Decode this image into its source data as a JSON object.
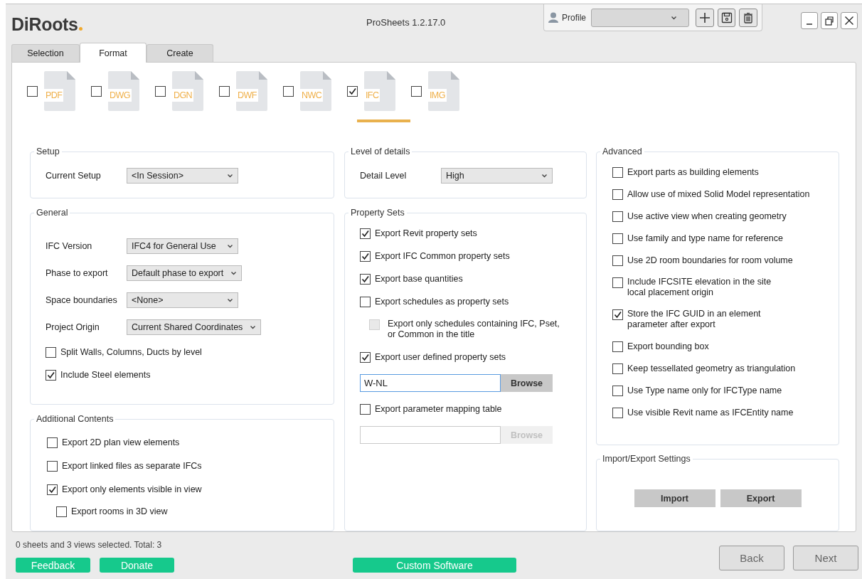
{
  "window": {
    "logo": "DiRoots",
    "title": "ProSheets 1.2.17.0"
  },
  "profile": {
    "label": "Profile"
  },
  "tabs": [
    {
      "label": "Selection",
      "selected": false
    },
    {
      "label": "Format",
      "selected": true
    },
    {
      "label": "Create",
      "selected": false
    }
  ],
  "formats": [
    {
      "label": "PDF",
      "checked": false,
      "selected": false
    },
    {
      "label": "DWG",
      "checked": false,
      "selected": false
    },
    {
      "label": "DGN",
      "checked": false,
      "selected": false
    },
    {
      "label": "DWF",
      "checked": false,
      "selected": false
    },
    {
      "label": "NWC",
      "checked": false,
      "selected": false
    },
    {
      "label": "IFC",
      "checked": true,
      "selected": true
    },
    {
      "label": "IMG",
      "checked": false,
      "selected": false
    }
  ],
  "setup": {
    "title": "Setup",
    "fields": [
      {
        "label": "Current Setup",
        "value": "<In Session>"
      }
    ]
  },
  "general": {
    "title": "General",
    "fields": [
      {
        "label": "IFC Version",
        "value": "IFC4 for General Use"
      },
      {
        "label": "Phase to export",
        "value": "Default phase to export"
      },
      {
        "label": "Space boundaries",
        "value": "<None>"
      },
      {
        "label": "Project Origin",
        "value": "Current Shared Coordinates"
      }
    ],
    "options": [
      {
        "label": "Split Walls, Columns, Ducts by level",
        "checked": false
      },
      {
        "label": "Include Steel elements",
        "checked": true
      }
    ]
  },
  "additional_contents": {
    "title": "Additional Contents",
    "options": [
      {
        "label": "Export 2D plan view elements",
        "checked": false
      },
      {
        "label": "Export linked files as separate IFCs",
        "checked": false
      },
      {
        "label": "Export only elements visible in view",
        "checked": true,
        "children": [
          {
            "label": "Export rooms in 3D view",
            "checked": false
          }
        ]
      }
    ]
  },
  "level_of_details": {
    "title": "Level of details",
    "fields": [
      {
        "label": "Detail Level",
        "value": "High"
      }
    ]
  },
  "property_sets": {
    "title": "Property Sets",
    "items": [
      {
        "kind": "checkbox",
        "label": "Export Revit property sets",
        "checked": true,
        "disabled": false
      },
      {
        "kind": "checkbox",
        "label": "Export IFC Common property sets",
        "checked": true,
        "disabled": false
      },
      {
        "kind": "checkbox",
        "label": "Export base quantities",
        "checked": true,
        "disabled": false
      },
      {
        "kind": "checkbox",
        "label": "Export schedules as property sets",
        "checked": false,
        "disabled": false,
        "children": [
          {
            "label": "Export only schedules containing IFC, Pset,\nor Common in the title",
            "checked": false,
            "disabled": true
          }
        ]
      },
      {
        "kind": "checkbox",
        "label": "Export user defined property sets",
        "checked": true,
        "disabled": false
      },
      {
        "kind": "file",
        "value": "W-NL",
        "button": "Browse",
        "focused": true,
        "disabled": false
      },
      {
        "kind": "checkbox",
        "label": "Export parameter mapping table",
        "checked": false,
        "disabled": false
      },
      {
        "kind": "file",
        "button": "Browse",
        "focused": false,
        "disabled": true
      }
    ]
  },
  "advanced": {
    "title": "Advanced",
    "options": [
      {
        "label": "Export parts as building elements",
        "checked": false
      },
      {
        "label": "Allow use of mixed Solid Model representation",
        "checked": false
      },
      {
        "label": "Use active view when creating geometry",
        "checked": false
      },
      {
        "label": "Use family and type name for reference",
        "checked": false
      },
      {
        "label": "Use 2D room boundaries for room volume",
        "checked": false
      },
      {
        "label": "Include IFCSITE elevation in the site\nlocal placement origin",
        "checked": false
      },
      {
        "label": "Store the IFC GUID in an element\nparameter after export",
        "checked": true
      },
      {
        "label": "Export bounding box",
        "checked": false
      },
      {
        "label": "Keep tessellated geometry as triangulation",
        "checked": false
      },
      {
        "label": "Use Type name only for IFCType name",
        "checked": false
      },
      {
        "label": "Use visible Revit name as IFCEntity name",
        "checked": false
      }
    ]
  },
  "import_export": {
    "title": "Import/Export Settings",
    "buttons": [
      "Import",
      "Export"
    ]
  },
  "status_bar": {
    "text": "0 sheets and 3 views selected. Total: 3",
    "links": [
      "Feedback",
      "Donate"
    ],
    "promo": "Custom Software"
  },
  "navigation": [
    "Back",
    "Next"
  ]
}
